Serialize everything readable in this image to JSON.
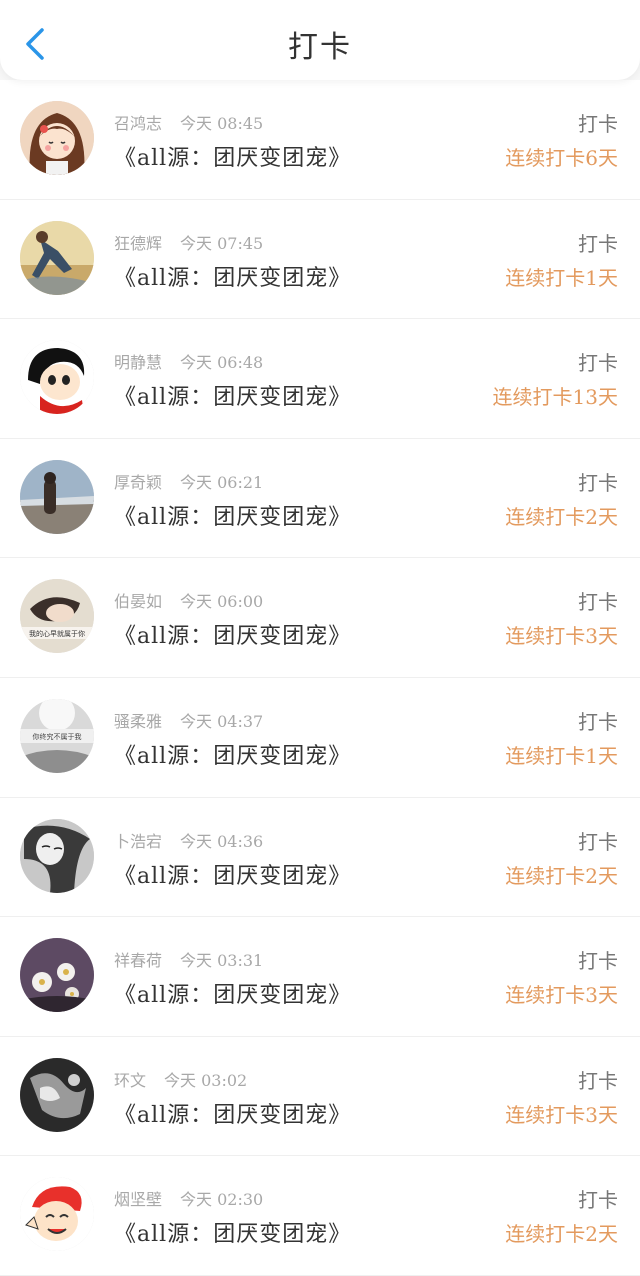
{
  "header": {
    "title": "打卡",
    "back_icon": "chevron-left-icon",
    "accent": "#2a95e8"
  },
  "colors": {
    "streak": "#e39a5e"
  },
  "items": [
    {
      "name": "召鸿志",
      "time": "今天 08:45",
      "book": "《all源：团厌变团宠》",
      "action": "打卡",
      "streak": "连续打卡6天"
    },
    {
      "name": "狂德辉",
      "time": "今天 07:45",
      "book": "《all源：团厌变团宠》",
      "action": "打卡",
      "streak": "连续打卡1天"
    },
    {
      "name": "明静慧",
      "time": "今天 06:48",
      "book": "《all源：团厌变团宠》",
      "action": "打卡",
      "streak": "连续打卡13天"
    },
    {
      "name": "厚奇颖",
      "time": "今天 06:21",
      "book": "《all源：团厌变团宠》",
      "action": "打卡",
      "streak": "连续打卡2天"
    },
    {
      "name": "伯晏如",
      "time": "今天 06:00",
      "book": "《all源：团厌变团宠》",
      "action": "打卡",
      "streak": "连续打卡3天",
      "avatar_text": "我的心早就属于你"
    },
    {
      "name": "骚柔雅",
      "time": "今天 04:37",
      "book": "《all源：团厌变团宠》",
      "action": "打卡",
      "streak": "连续打卡1天",
      "avatar_text": "你终究不属于我"
    },
    {
      "name": "卜浩宕",
      "time": "今天 04:36",
      "book": "《all源：团厌变团宠》",
      "action": "打卡",
      "streak": "连续打卡2天"
    },
    {
      "name": "祥春荷",
      "time": "今天 03:31",
      "book": "《all源：团厌变团宠》",
      "action": "打卡",
      "streak": "连续打卡3天"
    },
    {
      "name": "环文",
      "time": "今天 03:02",
      "book": "《all源：团厌变团宠》",
      "action": "打卡",
      "streak": "连续打卡3天"
    },
    {
      "name": "烟坚壁",
      "time": "今天 02:30",
      "book": "《all源：团厌变团宠》",
      "action": "打卡",
      "streak": "连续打卡2天"
    }
  ]
}
